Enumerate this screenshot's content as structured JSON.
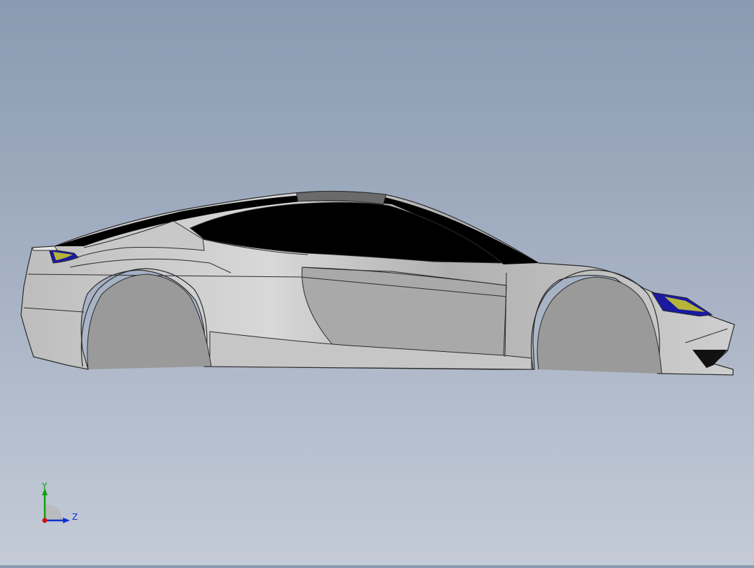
{
  "viewport": {
    "model_name": "sports-car-body",
    "colors": {
      "background_top": "#8a9ab0",
      "background_bottom": "#c4cbd7",
      "body_light": "#d6d6d6",
      "body_mid": "#b4b4b4",
      "body_dark": "#8e8e8e",
      "edge": "#2a2a2a",
      "glass": "#000000",
      "lamp_blue": "#1a1aa0",
      "lamp_yellow": "#b7b43a"
    }
  },
  "triad": {
    "y_label": "Y",
    "z_label": "Z",
    "colors": {
      "y": "#10a010",
      "z": "#1030d0",
      "x": "#d01010"
    }
  }
}
